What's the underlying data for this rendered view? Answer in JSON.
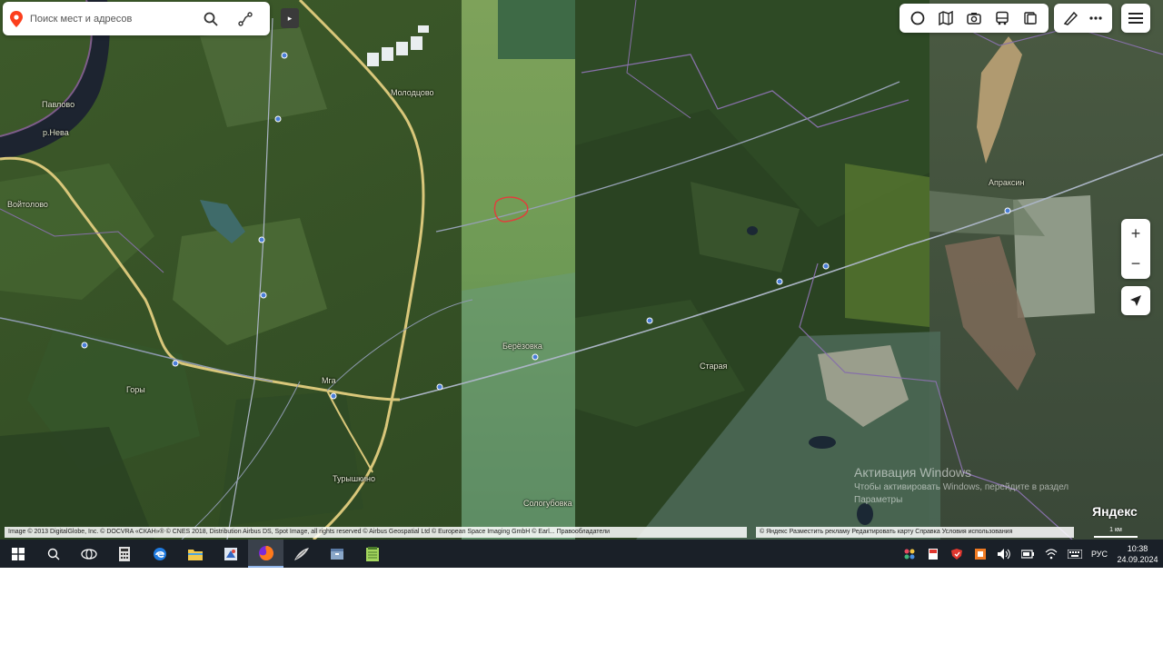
{
  "search": {
    "placeholder": "Поиск мест и адресов"
  },
  "map": {
    "places": [
      {
        "name": "Молодцово"
      },
      {
        "name": "р.Нева"
      },
      {
        "name": "Павлово"
      },
      {
        "name": "Мга"
      },
      {
        "name": "Берёзовка"
      },
      {
        "name": "Старая"
      },
      {
        "name": "Турышкино"
      },
      {
        "name": "Апраксин"
      },
      {
        "name": "Сологубовка"
      },
      {
        "name": "Горы"
      },
      {
        "name": "Войтолово"
      }
    ]
  },
  "watermark": {
    "line1": "Активация Windows",
    "line2": "Чтобы активировать Windows, перейдите в раздел",
    "line3": "Параметры"
  },
  "brand": "Яндекс",
  "copyright": {
    "left": "Image © 2013 DigitalGlobe, Inc. © DOCVRA «СКАН»® © CNES 2018, Distribution Airbus DS, Spot Image, all rights reserved © Airbus Geospatial Ltd © European Space Imaging GmbH © Earl... Правообладатели",
    "right": "© Яндекс  Разместить рекламу  Редактировать карту  Справка  Условия использования"
  },
  "scale": "1 км",
  "taskbar": {
    "lang": "РУС",
    "time": "10:38",
    "date": "24.09.2024"
  },
  "colors": {
    "accent": "#fc3f1d",
    "taskbar": "#1a2028"
  }
}
